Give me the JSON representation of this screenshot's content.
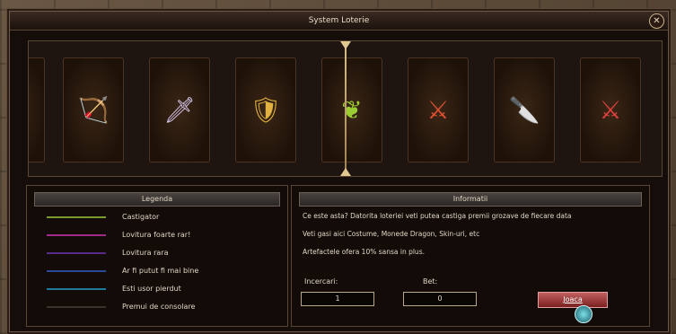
{
  "window": {
    "title": "System Loterie",
    "close_glyph": "✕"
  },
  "reel": {
    "items": [
      {
        "icon": "blue-bow-icon",
        "glyph": "🏹",
        "color": "#5aa0e0"
      },
      {
        "icon": "dagger-icon",
        "glyph": "🗡",
        "color": "#d8c8f0"
      },
      {
        "icon": "ornate-shield-icon",
        "glyph": "🛡",
        "color": "#e0b040"
      },
      {
        "icon": "green-fan-icon",
        "glyph": "❦",
        "color": "#9acd32"
      },
      {
        "icon": "red-sword-icon",
        "glyph": "⚔",
        "color": "#e05030"
      },
      {
        "icon": "silver-blade-icon",
        "glyph": "🔪",
        "color": "#c0c8d8"
      },
      {
        "icon": "red-spear-icon",
        "glyph": "⚔",
        "color": "#e04040"
      }
    ]
  },
  "legend": {
    "title": "Legenda",
    "rows": [
      {
        "label": "Castigator",
        "color": "#7a9a30"
      },
      {
        "label": "Lovitura foarte rar!",
        "color": "#a02c88"
      },
      {
        "label": "Lovitura rara",
        "color": "#5a2a88"
      },
      {
        "label": "Ar fi putut fi mai bine",
        "color": "#2a4a98"
      },
      {
        "label": "Esti usor pierdut",
        "color": "#1e7a98"
      },
      {
        "label": "Premui de consolare",
        "color": "#2a2220"
      }
    ]
  },
  "info": {
    "title": "Informatii",
    "line1": "Ce este asta? Datorita loteriei veti putea castiga premii grozave de fiecare data",
    "line2": "Veti gasi aici Costume, Monede Dragon, Skin-uri, etc",
    "line3": "Artefactele ofera 10% sansa in plus.",
    "tries_label": "Incercari:",
    "tries_value": "1",
    "bet_label": "Bet:",
    "bet_value": "0",
    "play_label": "Joaca"
  }
}
